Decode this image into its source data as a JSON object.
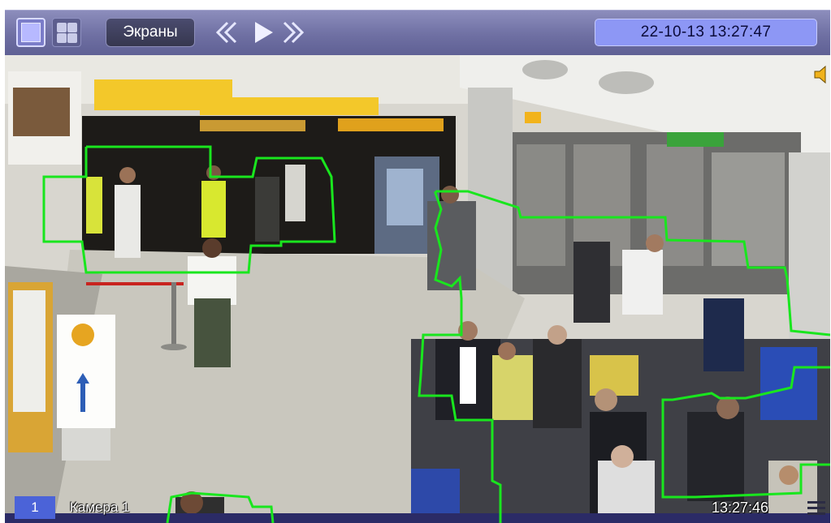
{
  "toolbar": {
    "screens_label": "Экраны",
    "datetime": "22-10-13  13:27:47"
  },
  "camera": {
    "number": "1",
    "name": "Камера 1",
    "time": "13:27:46"
  },
  "icons": {
    "single_view": "single-view-icon",
    "grid_view": "grid-view-icon",
    "rewind": "rewind-icon",
    "play": "play-icon",
    "fast_forward": "fast-forward-icon",
    "sound": "speaker-icon",
    "menu": "menu-icon"
  },
  "colors": {
    "toolbar": "#6f70a3",
    "datetime_bg": "#8d97f5",
    "detection_outline": "#19e61e",
    "camera_badge": "#4b63d8"
  }
}
